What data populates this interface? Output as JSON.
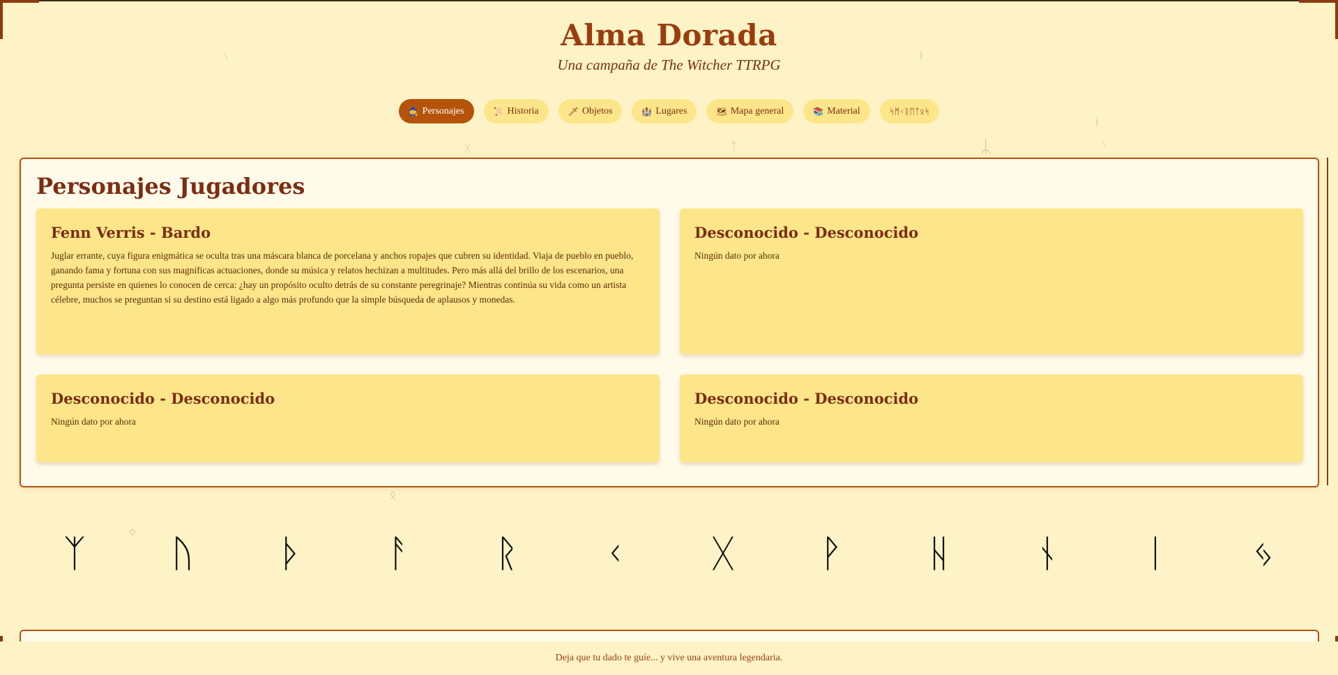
{
  "site": {
    "title": "Alma Dorada",
    "subtitle": "Una campaña de The Witcher TTRPG"
  },
  "nav": {
    "tabs": [
      {
        "icon": "🧙",
        "label": "Personajes",
        "active": true
      },
      {
        "icon": "📜",
        "label": "Historia",
        "active": false
      },
      {
        "icon": "🗡",
        "label": "Objetos",
        "active": false
      },
      {
        "icon": "🏰",
        "label": "Lugares",
        "active": false
      },
      {
        "icon": "🗺",
        "label": "Mapa general",
        "active": false
      },
      {
        "icon": "📚",
        "label": "Material",
        "active": false
      },
      {
        "icon": "",
        "label": "ᛋᛗᚲᚱᛖᛏᛟᛋ",
        "active": false
      }
    ]
  },
  "main": {
    "section_title": "Personajes Jugadores",
    "characters": [
      {
        "title": "Fenn Verris - Bardo",
        "text": "Juglar errante, cuya figura enigmática se oculta tras una máscara blanca de porcelana y anchos ropajes que cubren su identidad. Viaja de pueblo en pueblo, ganando fama y fortuna con sus magníficas actuaciones, donde su música y relatos hechizan a multitudes. Pero más allá del brillo de los escenarios, una pregunta persiste en quienes lo conocen de cerca: ¿hay un propósito oculto detrás de su constante peregrinaje? Mientras continúa su vida como un artista célebre, muchos se preguntan si su destino está ligado a algo más profundo que la simple búsqueda de aplausos y monedas."
      },
      {
        "title": "Desconocido - Desconocido",
        "text": "Ningún dato por ahora"
      },
      {
        "title": "Desconocido - Desconocido",
        "text": "Ningún dato por ahora"
      },
      {
        "title": "Desconocido - Desconocido",
        "text": "Ningún dato por ahora"
      }
    ]
  },
  "runes": [
    "ᛉ",
    "ᚢ",
    "ᚦ",
    "ᚨ",
    "ᚱ",
    "ᚲ",
    "ᚷ",
    "ᚹ",
    "ᚺ",
    "ᚾ",
    "ᛁ",
    "ᛃ"
  ],
  "footer": {
    "text": "Deja que tu dado te guíe... y vive una aventura legendaria."
  },
  "colors": {
    "background": "#fef3c7",
    "accent": "#b45309",
    "card": "#fde68a",
    "title": "#9a3d0e"
  }
}
